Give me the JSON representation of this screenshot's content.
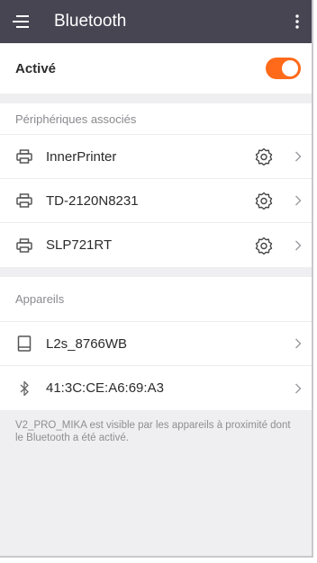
{
  "appbar": {
    "title": "Bluetooth",
    "menu_icon": "hamburger-icon",
    "more_icon": "more-vert-icon"
  },
  "toggle": {
    "label": "Activé",
    "state": "on",
    "color": "#ff6a1a"
  },
  "paired": {
    "header": "Périphériques associés",
    "items": [
      {
        "name": "InnerPrinter",
        "icon": "printer-icon"
      },
      {
        "name": "TD-2120N8231",
        "icon": "printer-icon"
      },
      {
        "name": "SLP721RT",
        "icon": "printer-icon"
      }
    ]
  },
  "available": {
    "header": "Appareils",
    "items": [
      {
        "name": "L2s_8766WB",
        "icon": "tablet-icon"
      },
      {
        "name": "41:3C:CE:A6:69:A3",
        "icon": "bluetooth-icon"
      }
    ]
  },
  "footer": {
    "note": "V2_PRO_MIKA est visible par les appareils à proximité dont le Bluetooth a été activé."
  },
  "colors": {
    "appbar_bg": "#474552",
    "accent": "#ff6a1a",
    "background": "#efeff1"
  }
}
